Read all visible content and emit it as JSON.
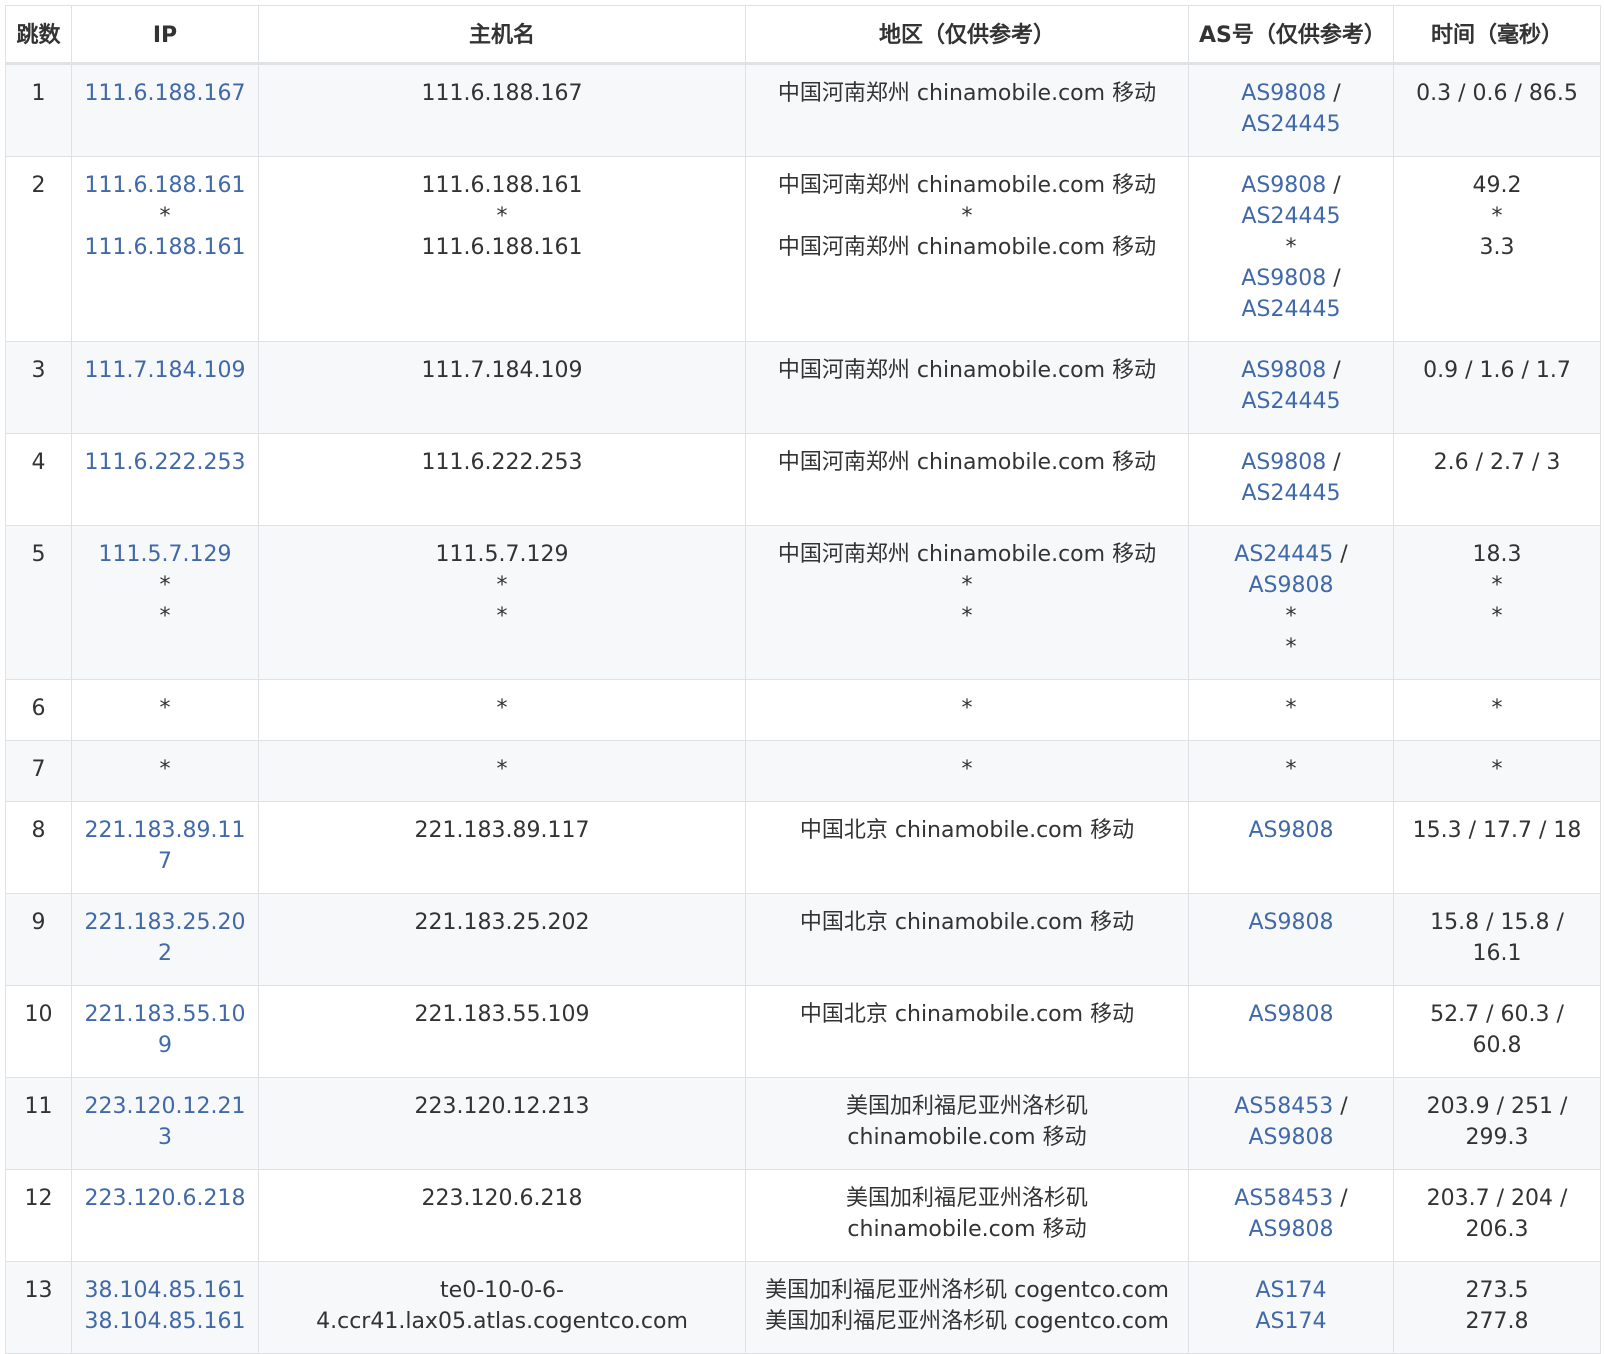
{
  "table": {
    "headers": {
      "hop": "跳数",
      "ip": "IP",
      "host": "主机名",
      "region": "地区（仅供参考）",
      "as": "AS号（仅供参考）",
      "time": "时间（毫秒）"
    },
    "rows": [
      {
        "hop": "1",
        "ip": [
          "111.6.188.167"
        ],
        "host": [
          "111.6.188.167"
        ],
        "region": [
          "中国河南郑州 chinamobile.com 移动"
        ],
        "as": [
          "AS9808 /",
          "AS24445"
        ],
        "time": [
          "0.3 / 0.6 / 86.5"
        ]
      },
      {
        "hop": "2",
        "ip": [
          "111.6.188.161",
          "*",
          "111.6.188.161"
        ],
        "host": [
          "111.6.188.161",
          "*",
          "111.6.188.161"
        ],
        "region": [
          "中国河南郑州 chinamobile.com 移动",
          "*",
          "中国河南郑州 chinamobile.com 移动"
        ],
        "as": [
          "AS9808 /",
          "AS24445",
          "*",
          "AS9808 /",
          "AS24445"
        ],
        "time": [
          "49.2",
          "*",
          "3.3"
        ]
      },
      {
        "hop": "3",
        "ip": [
          "111.7.184.109"
        ],
        "host": [
          "111.7.184.109"
        ],
        "region": [
          "中国河南郑州 chinamobile.com 移动"
        ],
        "as": [
          "AS9808 /",
          "AS24445"
        ],
        "time": [
          "0.9 / 1.6 / 1.7"
        ]
      },
      {
        "hop": "4",
        "ip": [
          "111.6.222.253"
        ],
        "host": [
          "111.6.222.253"
        ],
        "region": [
          "中国河南郑州 chinamobile.com 移动"
        ],
        "as": [
          "AS9808 /",
          "AS24445"
        ],
        "time": [
          "2.6 / 2.7 / 3"
        ]
      },
      {
        "hop": "5",
        "ip": [
          "111.5.7.129",
          "*",
          "*"
        ],
        "host": [
          "111.5.7.129",
          "*",
          "*"
        ],
        "region": [
          "中国河南郑州 chinamobile.com 移动",
          "*",
          "*"
        ],
        "as": [
          "AS24445 /",
          "AS9808",
          "*",
          "*"
        ],
        "time": [
          "18.3",
          "*",
          "*"
        ]
      },
      {
        "hop": "6",
        "ip": [
          "*"
        ],
        "host": [
          "*"
        ],
        "region": [
          "*"
        ],
        "as": [
          "*"
        ],
        "time": [
          "*"
        ]
      },
      {
        "hop": "7",
        "ip": [
          "*"
        ],
        "host": [
          "*"
        ],
        "region": [
          "*"
        ],
        "as": [
          "*"
        ],
        "time": [
          "*"
        ]
      },
      {
        "hop": "8",
        "ip": [
          "221.183.89.117"
        ],
        "host": [
          "221.183.89.117"
        ],
        "region": [
          "中国北京 chinamobile.com 移动"
        ],
        "as": [
          "AS9808"
        ],
        "time": [
          "15.3 / 17.7 / 18"
        ]
      },
      {
        "hop": "9",
        "ip": [
          "221.183.25.202"
        ],
        "host": [
          "221.183.25.202"
        ],
        "region": [
          "中国北京 chinamobile.com 移动"
        ],
        "as": [
          "AS9808"
        ],
        "time": [
          "15.8 / 15.8 / 16.1"
        ]
      },
      {
        "hop": "10",
        "ip": [
          "221.183.55.109"
        ],
        "host": [
          "221.183.55.109"
        ],
        "region": [
          "中国北京 chinamobile.com 移动"
        ],
        "as": [
          "AS9808"
        ],
        "time": [
          "52.7 / 60.3 / 60.8"
        ]
      },
      {
        "hop": "11",
        "ip": [
          "223.120.12.213"
        ],
        "host": [
          "223.120.12.213"
        ],
        "region": [
          "美国加利福尼亚州洛杉矶",
          "chinamobile.com 移动"
        ],
        "as": [
          "AS58453 /",
          "AS9808"
        ],
        "time": [
          "203.9 / 251 /",
          "299.3"
        ]
      },
      {
        "hop": "12",
        "ip": [
          "223.120.6.218"
        ],
        "host": [
          "223.120.6.218"
        ],
        "region": [
          "美国加利福尼亚州洛杉矶",
          "chinamobile.com 移动"
        ],
        "as": [
          "AS58453 /",
          "AS9808"
        ],
        "time": [
          "203.7 / 204 /",
          "206.3"
        ]
      },
      {
        "hop": "13",
        "ip": [
          "38.104.85.161",
          "38.104.85.161"
        ],
        "host": [
          "te0-10-0-6-",
          "4.ccr41.lax05.atlas.cogentco.com"
        ],
        "region": [
          "美国加利福尼亚州洛杉矶 cogentco.com",
          "美国加利福尼亚州洛杉矶 cogentco.com"
        ],
        "as": [
          "AS174",
          "AS174"
        ],
        "time": [
          "273.5",
          "277.8"
        ]
      }
    ]
  },
  "colors": {
    "link": "#4169a8",
    "text": "#333333",
    "border": "#dfe2e5",
    "stripe": "#f6f8fa"
  }
}
